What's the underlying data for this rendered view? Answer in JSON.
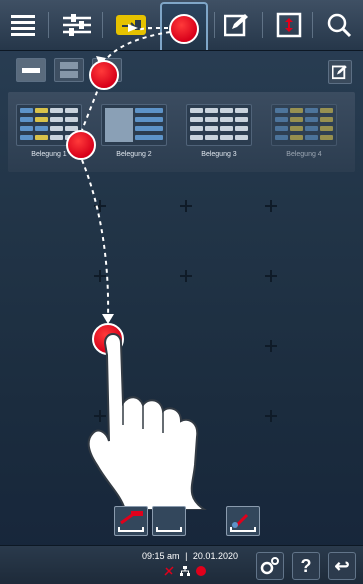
{
  "toolbar": {
    "items": [
      "menu-icon",
      "filter-sliders-icon",
      "load-tray-icon",
      "active-tab",
      "edit-icon",
      "resize-icon",
      "search-icon"
    ],
    "active_color": "#e6c200",
    "edit_color": "#ffffff"
  },
  "layout_buttons": [
    "single-layout",
    "split-layout",
    "grid-layout"
  ],
  "belegung": {
    "items": [
      {
        "label": "Belegung 1"
      },
      {
        "label": "Belegung 2"
      },
      {
        "label": "Belegung 3"
      },
      {
        "label": "Belegung 4"
      }
    ]
  },
  "status": {
    "time": "09:15 am",
    "date": "20.01.2020",
    "separator": "|"
  },
  "bottom_buttons": {
    "help_label": "?",
    "back_label": "↩"
  },
  "colors": {
    "marker": "#e0001b",
    "accent": "#e6c200",
    "background": "#1b2c3e"
  }
}
